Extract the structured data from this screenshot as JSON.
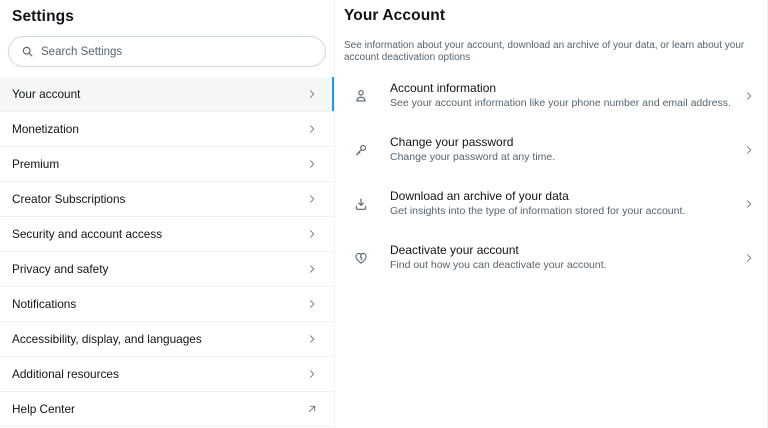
{
  "sidebar": {
    "title": "Settings",
    "search": {
      "placeholder": "Search Settings"
    },
    "items": [
      {
        "label": "Your account",
        "selected": true,
        "trailing": "chevron"
      },
      {
        "label": "Monetization",
        "selected": false,
        "trailing": "chevron"
      },
      {
        "label": "Premium",
        "selected": false,
        "trailing": "chevron"
      },
      {
        "label": "Creator Subscriptions",
        "selected": false,
        "trailing": "chevron"
      },
      {
        "label": "Security and account access",
        "selected": false,
        "trailing": "chevron"
      },
      {
        "label": "Privacy and safety",
        "selected": false,
        "trailing": "chevron"
      },
      {
        "label": "Notifications",
        "selected": false,
        "trailing": "chevron"
      },
      {
        "label": "Accessibility, display, and languages",
        "selected": false,
        "trailing": "chevron"
      },
      {
        "label": "Additional resources",
        "selected": false,
        "trailing": "chevron"
      },
      {
        "label": "Help Center",
        "selected": false,
        "trailing": "external-link"
      }
    ]
  },
  "main": {
    "title": "Your Account",
    "description": "See information about your account, download an archive of your data, or learn about your account deactivation options",
    "items": [
      {
        "icon": "person-icon",
        "title": "Account information",
        "subtitle": "See your account information like your phone number and email address."
      },
      {
        "icon": "key-icon",
        "title": "Change your password",
        "subtitle": "Change your password at any time."
      },
      {
        "icon": "download-icon",
        "title": "Download an archive of your data",
        "subtitle": "Get insights into the type of information stored for your account."
      },
      {
        "icon": "broken-heart-icon",
        "title": "Deactivate your account",
        "subtitle": "Find out how you can deactivate your account."
      }
    ]
  },
  "colors": {
    "accent": "#1d9bf0",
    "text_primary": "#0f1419",
    "text_secondary": "#536471",
    "divider": "#eff3f4",
    "selected_bg": "#f5f7f7"
  }
}
